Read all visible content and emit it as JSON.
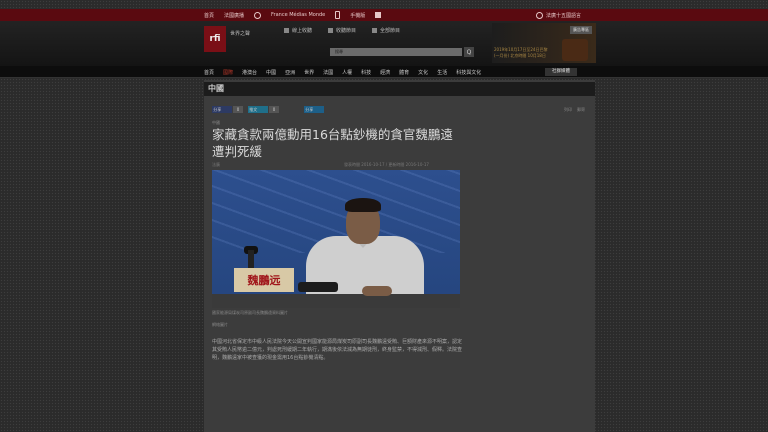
{
  "topbar": {
    "home": "首頁",
    "language": "法國廣播",
    "search": "搜尋",
    "france_medias": "France Médias Monde",
    "mobile": "手機版",
    "facebook": "f",
    "right_link": "法廣十五國語言"
  },
  "header": {
    "logo": "rfi",
    "logo_text": "世界之聲",
    "radio": [
      "線上收聽",
      "收聽節目",
      "全部節目"
    ],
    "search_placeholder": "搜尋",
    "search_button": "Q",
    "ad_badge": "廣告專區",
    "ad_text_1": "2019年10月17日至24日巴黎",
    "ad_text_2": "(一月份) 北京時間 10月18日"
  },
  "nav": {
    "items": [
      "首頁",
      "國際",
      "港澳台",
      "中國",
      "亞洲",
      "世界",
      "法國",
      "人權",
      "科技",
      "經濟",
      "體育",
      "文化",
      "生活",
      "科技與文化"
    ],
    "active_index": 1,
    "social": "社群媒體"
  },
  "article": {
    "section": "中國",
    "share": {
      "fb": "分享",
      "fb_count": "0",
      "tw": "推文",
      "tw_count": "0",
      "li": "分享"
    },
    "share_right": [
      "列印",
      "郵寄"
    ],
    "kicker": "中國",
    "title": "家藏貪款兩億動用16台點鈔機的貪官魏鵬遠遭判死緩",
    "byline": "法廣",
    "pubdate": "發表時間 2016-10-17 / 更新時間 2016-10-17",
    "photo_nameplate": "魏鵬远",
    "caption": "國家能源局煤炭司原副司長魏鵬遠資料圖片",
    "credit": "網絡圖片",
    "body": "中國河北省保定市中級人民法院今天公開宣判國家能源局煤炭司原副司長魏鵬遠受賄、巨額財產來源不明案，認定其受賄人民幣逾二億元，判處死刑緩期二年執行，期滿後依法減為無期徒刑，終身監禁，不得減刑、假釋。法院查明，魏鵬遠家中被查獲的現金需用16台點鈔機清點。"
  }
}
